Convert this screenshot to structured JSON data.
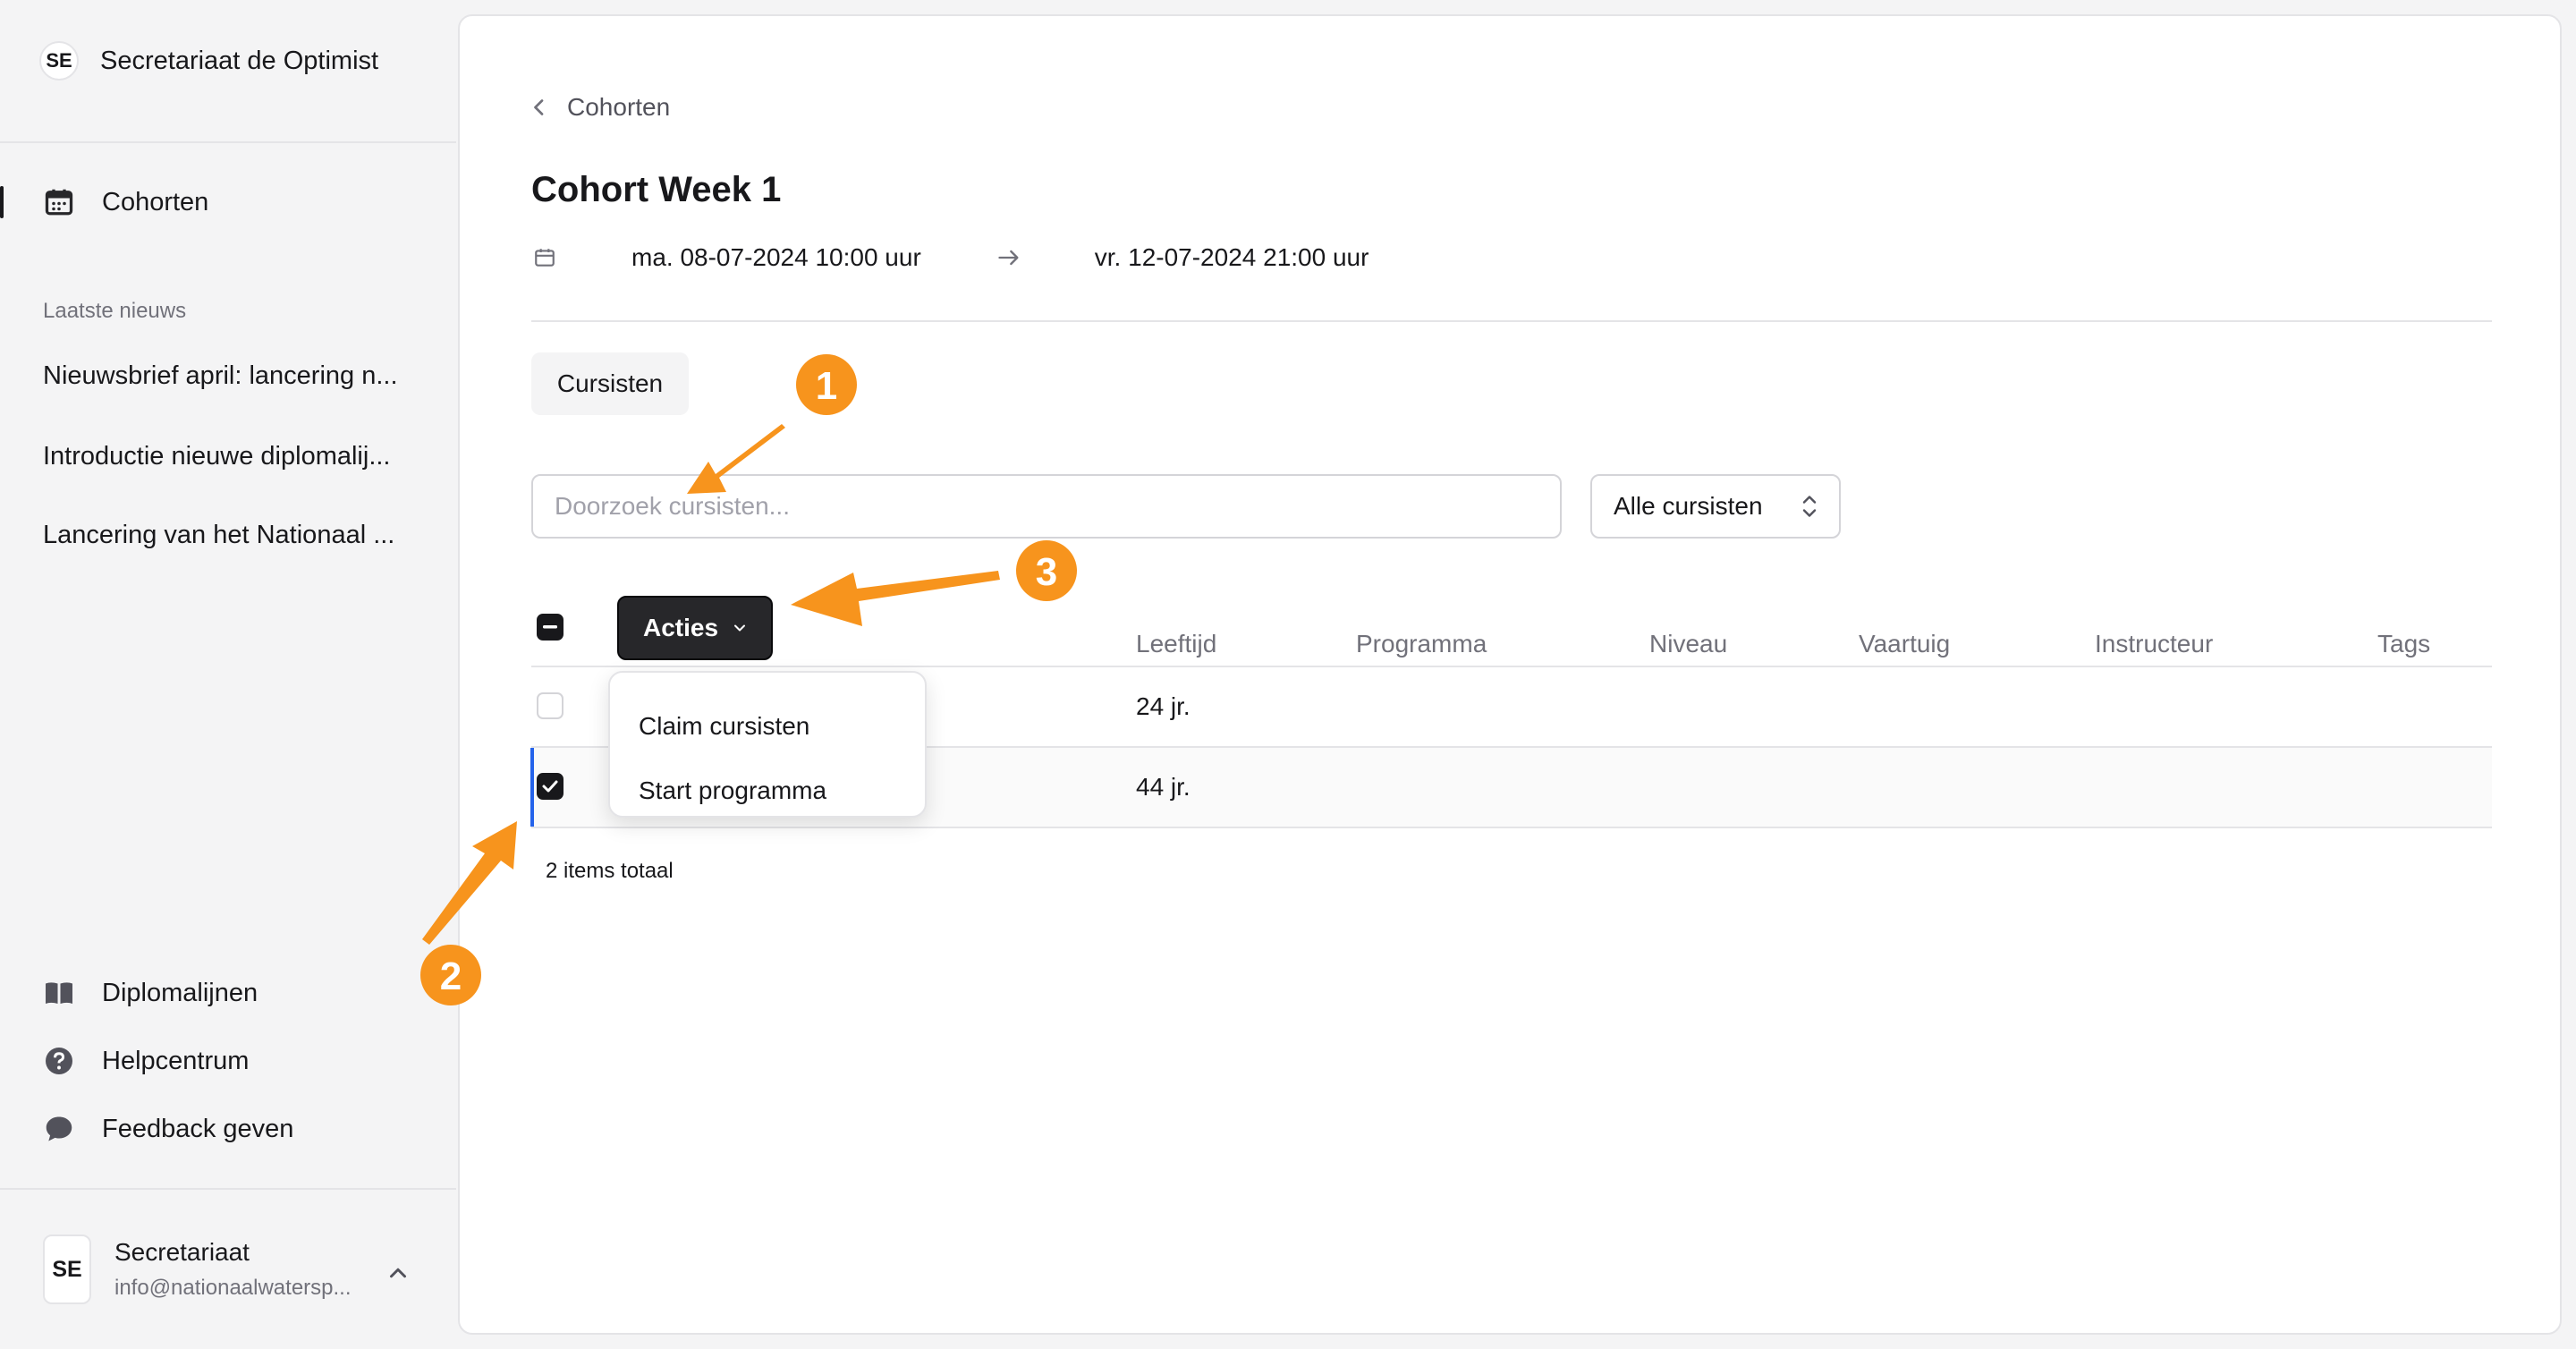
{
  "sidebar": {
    "org": {
      "initials": "SE",
      "name": "Secretariaat de Optimist"
    },
    "nav_primary": [
      {
        "label": "Cohorten",
        "icon": "calendar-icon",
        "active": true
      }
    ],
    "news_heading": "Laatste nieuws",
    "news": [
      "Nieuwsbrief april: lancering n...",
      "Introductie nieuwe diplomalij...",
      "Lancering van het Nationaal ..."
    ],
    "nav_bottom": [
      {
        "label": "Diplomalijnen",
        "icon": "book-icon"
      },
      {
        "label": "Helpcentrum",
        "icon": "question-icon"
      },
      {
        "label": "Feedback geven",
        "icon": "chat-bubble-icon"
      }
    ],
    "user": {
      "initials": "SE",
      "name": "Secretariaat",
      "email": "info@nationaalwatersp..."
    }
  },
  "main": {
    "breadcrumb": "Cohorten",
    "title": "Cohort Week 1",
    "start_date": "ma. 08-07-2024 10:00 uur",
    "end_date": "vr. 12-07-2024 21:00 uur",
    "tab": "Cursisten",
    "search": {
      "placeholder": "Doorzoek cursisten...",
      "value": ""
    },
    "filter": {
      "selected": "Alle cursisten"
    },
    "table": {
      "actions_label": "Acties",
      "headers": [
        "Leeftijd",
        "Programma",
        "Niveau",
        "Vaartuig",
        "Instructeur",
        "Tags"
      ],
      "rows": [
        {
          "name_tail": "",
          "age": "24 jr.",
          "checked": false
        },
        {
          "name_tail": "t",
          "age": "44 jr.",
          "checked": true
        }
      ],
      "total": "2 items totaal"
    },
    "actions_menu": [
      "Claim cursisten",
      "Start programma"
    ]
  },
  "annotations": {
    "accent": "#f7941d",
    "labels": [
      "1",
      "2",
      "3"
    ]
  }
}
